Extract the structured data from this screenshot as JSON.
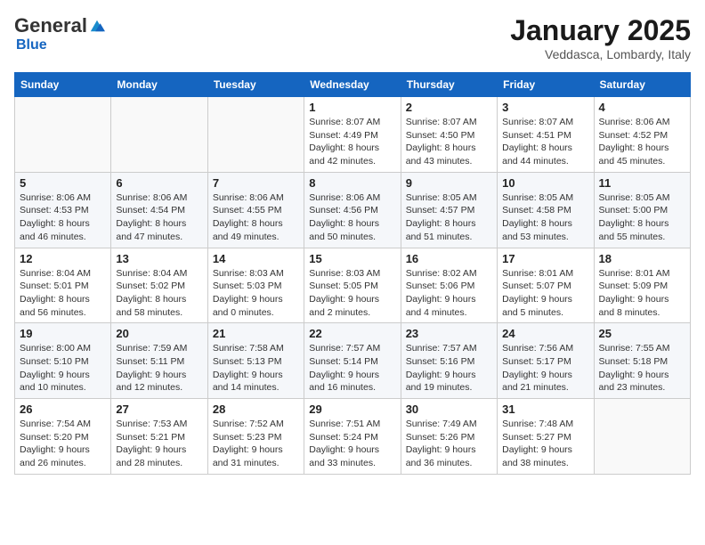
{
  "header": {
    "logo_general": "General",
    "logo_blue": "Blue",
    "month_title": "January 2025",
    "location": "Veddasca, Lombardy, Italy"
  },
  "weekdays": [
    "Sunday",
    "Monday",
    "Tuesday",
    "Wednesday",
    "Thursday",
    "Friday",
    "Saturday"
  ],
  "weeks": [
    [
      {
        "day": "",
        "info": ""
      },
      {
        "day": "",
        "info": ""
      },
      {
        "day": "",
        "info": ""
      },
      {
        "day": "1",
        "info": "Sunrise: 8:07 AM\nSunset: 4:49 PM\nDaylight: 8 hours and 42 minutes."
      },
      {
        "day": "2",
        "info": "Sunrise: 8:07 AM\nSunset: 4:50 PM\nDaylight: 8 hours and 43 minutes."
      },
      {
        "day": "3",
        "info": "Sunrise: 8:07 AM\nSunset: 4:51 PM\nDaylight: 8 hours and 44 minutes."
      },
      {
        "day": "4",
        "info": "Sunrise: 8:06 AM\nSunset: 4:52 PM\nDaylight: 8 hours and 45 minutes."
      }
    ],
    [
      {
        "day": "5",
        "info": "Sunrise: 8:06 AM\nSunset: 4:53 PM\nDaylight: 8 hours and 46 minutes."
      },
      {
        "day": "6",
        "info": "Sunrise: 8:06 AM\nSunset: 4:54 PM\nDaylight: 8 hours and 47 minutes."
      },
      {
        "day": "7",
        "info": "Sunrise: 8:06 AM\nSunset: 4:55 PM\nDaylight: 8 hours and 49 minutes."
      },
      {
        "day": "8",
        "info": "Sunrise: 8:06 AM\nSunset: 4:56 PM\nDaylight: 8 hours and 50 minutes."
      },
      {
        "day": "9",
        "info": "Sunrise: 8:05 AM\nSunset: 4:57 PM\nDaylight: 8 hours and 51 minutes."
      },
      {
        "day": "10",
        "info": "Sunrise: 8:05 AM\nSunset: 4:58 PM\nDaylight: 8 hours and 53 minutes."
      },
      {
        "day": "11",
        "info": "Sunrise: 8:05 AM\nSunset: 5:00 PM\nDaylight: 8 hours and 55 minutes."
      }
    ],
    [
      {
        "day": "12",
        "info": "Sunrise: 8:04 AM\nSunset: 5:01 PM\nDaylight: 8 hours and 56 minutes."
      },
      {
        "day": "13",
        "info": "Sunrise: 8:04 AM\nSunset: 5:02 PM\nDaylight: 8 hours and 58 minutes."
      },
      {
        "day": "14",
        "info": "Sunrise: 8:03 AM\nSunset: 5:03 PM\nDaylight: 9 hours and 0 minutes."
      },
      {
        "day": "15",
        "info": "Sunrise: 8:03 AM\nSunset: 5:05 PM\nDaylight: 9 hours and 2 minutes."
      },
      {
        "day": "16",
        "info": "Sunrise: 8:02 AM\nSunset: 5:06 PM\nDaylight: 9 hours and 4 minutes."
      },
      {
        "day": "17",
        "info": "Sunrise: 8:01 AM\nSunset: 5:07 PM\nDaylight: 9 hours and 5 minutes."
      },
      {
        "day": "18",
        "info": "Sunrise: 8:01 AM\nSunset: 5:09 PM\nDaylight: 9 hours and 8 minutes."
      }
    ],
    [
      {
        "day": "19",
        "info": "Sunrise: 8:00 AM\nSunset: 5:10 PM\nDaylight: 9 hours and 10 minutes."
      },
      {
        "day": "20",
        "info": "Sunrise: 7:59 AM\nSunset: 5:11 PM\nDaylight: 9 hours and 12 minutes."
      },
      {
        "day": "21",
        "info": "Sunrise: 7:58 AM\nSunset: 5:13 PM\nDaylight: 9 hours and 14 minutes."
      },
      {
        "day": "22",
        "info": "Sunrise: 7:57 AM\nSunset: 5:14 PM\nDaylight: 9 hours and 16 minutes."
      },
      {
        "day": "23",
        "info": "Sunrise: 7:57 AM\nSunset: 5:16 PM\nDaylight: 9 hours and 19 minutes."
      },
      {
        "day": "24",
        "info": "Sunrise: 7:56 AM\nSunset: 5:17 PM\nDaylight: 9 hours and 21 minutes."
      },
      {
        "day": "25",
        "info": "Sunrise: 7:55 AM\nSunset: 5:18 PM\nDaylight: 9 hours and 23 minutes."
      }
    ],
    [
      {
        "day": "26",
        "info": "Sunrise: 7:54 AM\nSunset: 5:20 PM\nDaylight: 9 hours and 26 minutes."
      },
      {
        "day": "27",
        "info": "Sunrise: 7:53 AM\nSunset: 5:21 PM\nDaylight: 9 hours and 28 minutes."
      },
      {
        "day": "28",
        "info": "Sunrise: 7:52 AM\nSunset: 5:23 PM\nDaylight: 9 hours and 31 minutes."
      },
      {
        "day": "29",
        "info": "Sunrise: 7:51 AM\nSunset: 5:24 PM\nDaylight: 9 hours and 33 minutes."
      },
      {
        "day": "30",
        "info": "Sunrise: 7:49 AM\nSunset: 5:26 PM\nDaylight: 9 hours and 36 minutes."
      },
      {
        "day": "31",
        "info": "Sunrise: 7:48 AM\nSunset: 5:27 PM\nDaylight: 9 hours and 38 minutes."
      },
      {
        "day": "",
        "info": ""
      }
    ]
  ]
}
